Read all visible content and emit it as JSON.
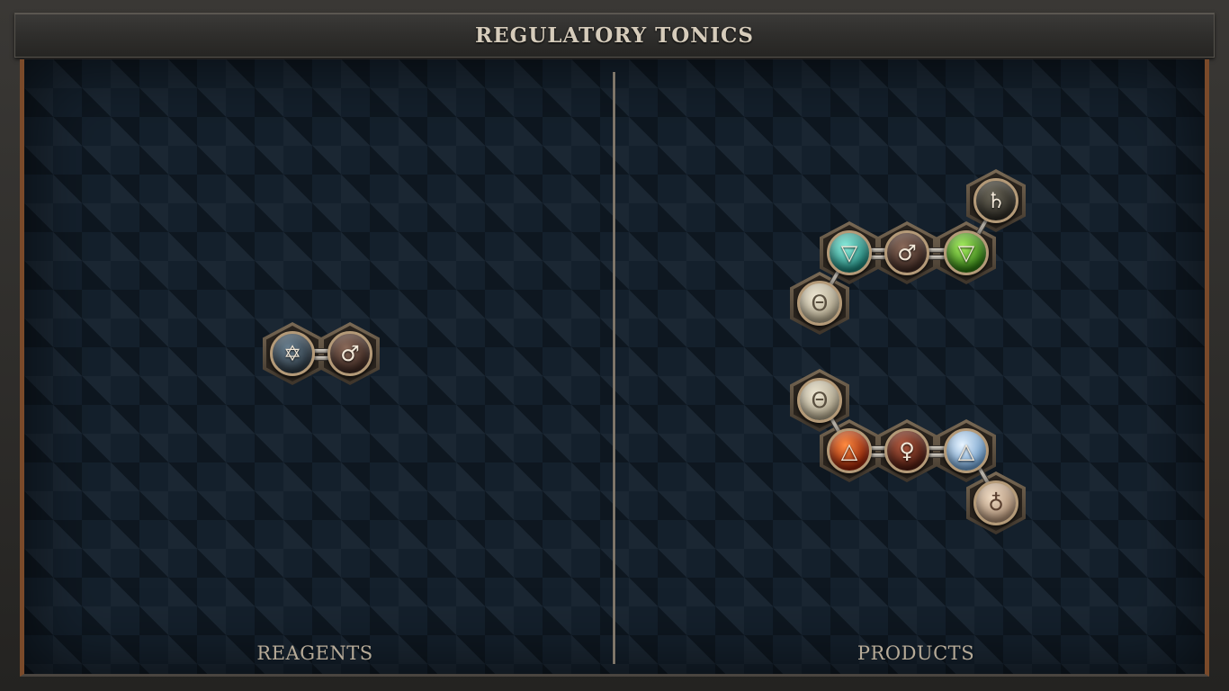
{
  "title": "REGULATORY TONICS",
  "panels": {
    "reagents_label": "REAGENTS",
    "products_label": "PRODUCTS"
  },
  "colors": {
    "frame": "#2b2a29",
    "board": "#14202c",
    "title_text": "#d6ccbb",
    "label_text": "#b7ab98",
    "side_trim": "#7a4a2a"
  },
  "reagents": {
    "molecule_1": {
      "atoms": [
        {
          "element": "quintessence",
          "symbol": "✡",
          "color": "#3a4a5a"
        },
        {
          "element": "iron",
          "symbol": "♂",
          "color": "#6a4a3a"
        }
      ]
    }
  },
  "products": {
    "molecule_1": {
      "atoms": [
        {
          "element": "salt",
          "symbol": "Θ",
          "color": "#d8d0b8"
        },
        {
          "element": "water",
          "symbol": "▽",
          "color": "#2aa8a0"
        },
        {
          "element": "iron",
          "symbol": "♂",
          "color": "#6a4a3a"
        },
        {
          "element": "earth",
          "symbol": "▽",
          "color": "#4ea828"
        },
        {
          "element": "lead",
          "symbol": "♄",
          "color": "#4a4438"
        }
      ]
    },
    "molecule_2": {
      "atoms": [
        {
          "element": "salt",
          "symbol": "Θ",
          "color": "#d8d0b8"
        },
        {
          "element": "fire",
          "symbol": "△",
          "color": "#d0481a"
        },
        {
          "element": "copper",
          "symbol": "♀",
          "color": "#7a3a2a"
        },
        {
          "element": "air",
          "symbol": "△",
          "color": "#a8c8e8"
        },
        {
          "element": "salt-variant",
          "symbol": "♁",
          "color": "#d8c0a8"
        }
      ]
    }
  }
}
